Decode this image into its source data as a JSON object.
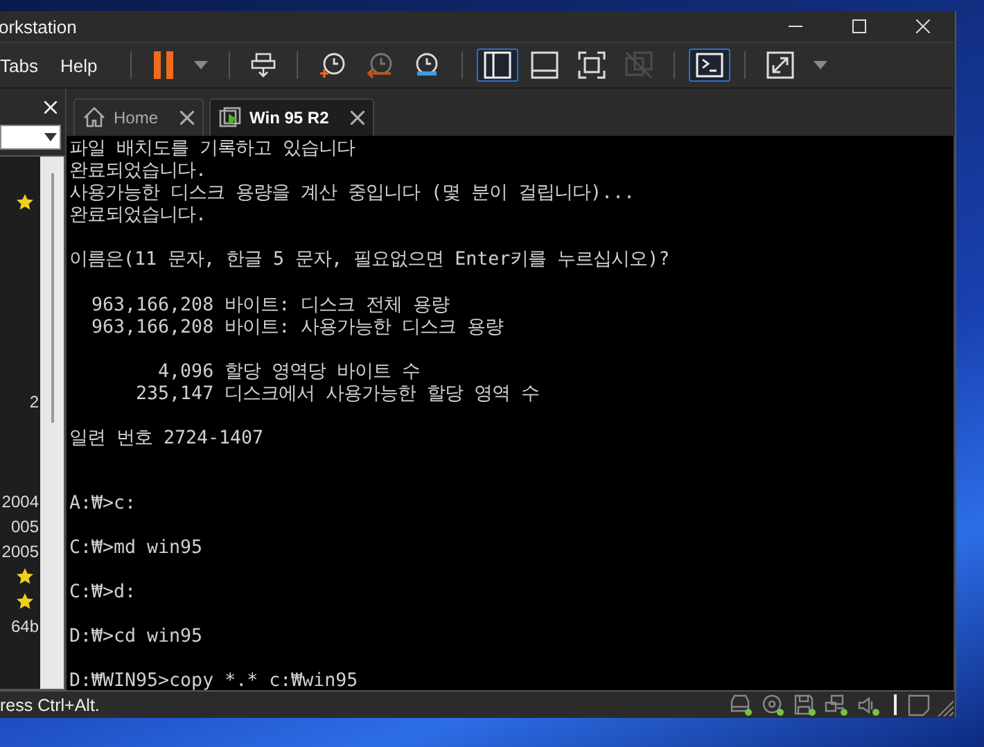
{
  "window": {
    "title": "orkstation"
  },
  "menu": [
    "Tabs",
    "Help"
  ],
  "toolbar": [
    {
      "kind": "pause",
      "selected": false,
      "disabled": false
    },
    {
      "kind": "caret",
      "selected": false,
      "disabled": false
    },
    {
      "kind": "send-keys",
      "selected": false,
      "disabled": false
    },
    {
      "kind": "snapshot",
      "selected": false,
      "disabled": false
    },
    {
      "kind": "revert",
      "selected": false,
      "disabled": false
    },
    {
      "kind": "manage",
      "selected": false,
      "disabled": false
    },
    {
      "kind": "library",
      "selected": true,
      "disabled": false
    },
    {
      "kind": "thumbnail",
      "selected": false,
      "disabled": false
    },
    {
      "kind": "fullscreen",
      "selected": false,
      "disabled": false
    },
    {
      "kind": "unity",
      "selected": false,
      "disabled": true
    },
    {
      "kind": "console",
      "selected": true,
      "disabled": false
    },
    {
      "kind": "stretch",
      "selected": false,
      "disabled": false
    },
    {
      "kind": "caret",
      "selected": false,
      "disabled": false
    }
  ],
  "sidebar": {
    "rows": [
      {
        "kind": "star"
      },
      {
        "kind": "blank"
      },
      {
        "kind": "blank"
      },
      {
        "kind": "blank"
      },
      {
        "kind": "blank"
      },
      {
        "kind": "blank"
      },
      {
        "kind": "blank"
      },
      {
        "kind": "blank"
      },
      {
        "kind": "text",
        "text": "2"
      },
      {
        "kind": "blank"
      },
      {
        "kind": "blank"
      },
      {
        "kind": "blank"
      },
      {
        "kind": "text",
        "text": "2004"
      },
      {
        "kind": "text",
        "text": "005"
      },
      {
        "kind": "text",
        "text": "2005"
      },
      {
        "kind": "star"
      },
      {
        "kind": "star"
      },
      {
        "kind": "text",
        "text": "64b"
      }
    ]
  },
  "tabs": [
    {
      "label": "Home",
      "kind": "home",
      "selected": false
    },
    {
      "label": "Win 95 R2",
      "kind": "vm",
      "selected": true
    }
  ],
  "console": {
    "lines": [
      {
        "kind": "text",
        "text": "파일 배치도를 기록하고 있습니다"
      },
      {
        "kind": "text",
        "text": "완료되었습니다."
      },
      {
        "kind": "text",
        "text": "사용가능한 디스크 용량을 계산 중입니다 (몇 분이 걸립니다)..."
      },
      {
        "kind": "text",
        "text": "완료되었습니다."
      },
      {
        "kind": "blank"
      },
      {
        "kind": "text",
        "text": "이름은(11 문자, 한글 5 문자, 필요없으면 Enter키를 누르십시오)?"
      },
      {
        "kind": "blank"
      },
      {
        "kind": "text",
        "text": "  963,166,208 바이트: 디스크 전체 용량"
      },
      {
        "kind": "text",
        "text": "  963,166,208 바이트: 사용가능한 디스크 용량"
      },
      {
        "kind": "blank"
      },
      {
        "kind": "text",
        "text": "        4,096 할당 영역당 바이트 수"
      },
      {
        "kind": "text",
        "text": "      235,147 디스크에서 사용가능한 할당 영역 수"
      },
      {
        "kind": "blank"
      },
      {
        "kind": "text",
        "text": "일련 번호 2724-1407"
      },
      {
        "kind": "blank"
      },
      {
        "kind": "blank"
      },
      {
        "kind": "text",
        "text": "A:₩>c:"
      },
      {
        "kind": "blank"
      },
      {
        "kind": "text",
        "text": "C:₩>md win95"
      },
      {
        "kind": "blank"
      },
      {
        "kind": "text",
        "text": "C:₩>d:"
      },
      {
        "kind": "blank"
      },
      {
        "kind": "text",
        "text": "D:₩>cd win95"
      },
      {
        "kind": "blank"
      },
      {
        "kind": "text",
        "text": "D:₩WIN95>copy *.* c:₩win95"
      }
    ]
  },
  "status_bar": {
    "hint": "ress Ctrl+Alt.",
    "devices": [
      {
        "kind": "disk",
        "active": true
      },
      {
        "kind": "cd",
        "active": true
      },
      {
        "kind": "floppy",
        "active": true
      },
      {
        "kind": "network",
        "active": true
      },
      {
        "kind": "sound",
        "active": true
      }
    ]
  }
}
